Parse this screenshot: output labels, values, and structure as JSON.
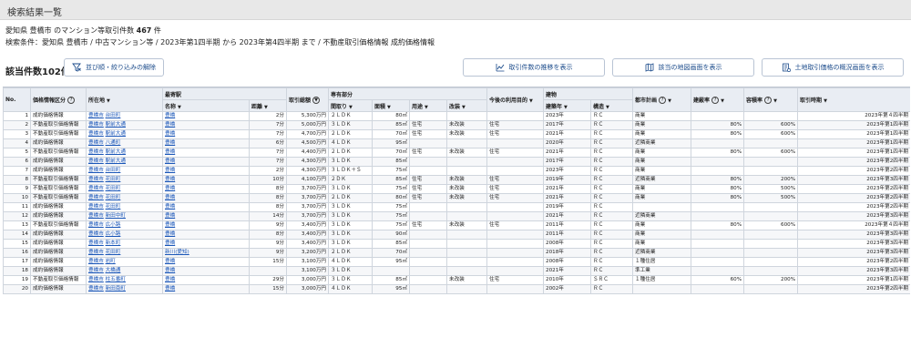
{
  "page_title": "検索結果一覧",
  "summary": {
    "prefix": "愛知県 豊橋市 のマンション等取引件数",
    "count": "467",
    "suffix": "件",
    "conditions": "検索条件：愛知県 豊橋市 / 中古マンション等 / 2023年第1四半期 から 2023年第4四半期 まで / 不動産取引価格情報 成約価格情報"
  },
  "result_count": "該当件数102件",
  "buttons": {
    "filter": "並び順・絞り込みの解除",
    "trend": "取引件数の推移を表示",
    "map": "該当の地図画面を表示",
    "overview": "土地取引価格の概況画面を表示"
  },
  "colors": {
    "link": "#1a56b8",
    "header_bg": "#e9edf3",
    "button_text": "#1a4a8a"
  },
  "table": {
    "headers": {
      "no": "No.",
      "price_type": "価格情報区分",
      "location": "所在地",
      "nearest_station": "最寄駅",
      "station_name": "名称",
      "distance": "距離",
      "total_price": "取引総額",
      "private_area": "専有部分",
      "layout": "間取り",
      "area": "面積",
      "usage": "用途",
      "renovation": "改装",
      "future_use": "今後の利用目的",
      "building": "建物",
      "built_year": "建築年",
      "structure": "構造",
      "city_plan": "都市計画",
      "coverage": "建蔽率",
      "far": "容積率",
      "period": "取引時期"
    },
    "rows": [
      {
        "no": "1",
        "type": "成約価格情報",
        "city": "豊橋市",
        "town": "台田町",
        "station": "豊橋",
        "dist": "2分",
        "price": "5,300万円",
        "layout": "２ＬＤＫ",
        "area": "80㎡",
        "usage": "",
        "reno": "",
        "future": "",
        "year": "2023年",
        "struct": "ＲＣ",
        "plan": "商業",
        "cov": "",
        "far": "",
        "period": "2023年第４四半期"
      },
      {
        "no": "2",
        "type": "不動産取引価格情報",
        "city": "豊橋市",
        "town": "駅前大通",
        "station": "豊橋",
        "dist": "7分",
        "price": "5,000万円",
        "layout": "３ＬＤＫ",
        "area": "85㎡",
        "usage": "住宅",
        "reno": "未改装",
        "future": "住宅",
        "year": "2017年",
        "struct": "ＲＣ",
        "plan": "商業",
        "cov": "80%",
        "far": "600%",
        "period": "2023年第1四半期"
      },
      {
        "no": "3",
        "type": "不動産取引価格情報",
        "city": "豊橋市",
        "town": "駅前大通",
        "station": "豊橋",
        "dist": "7分",
        "price": "4,700万円",
        "layout": "２ＬＤＫ",
        "area": "70㎡",
        "usage": "住宅",
        "reno": "未改装",
        "future": "住宅",
        "year": "2021年",
        "struct": "ＲＣ",
        "plan": "商業",
        "cov": "80%",
        "far": "600%",
        "period": "2023年第1四半期"
      },
      {
        "no": "4",
        "type": "成約価格情報",
        "city": "豊橋市",
        "town": "八通町",
        "station": "豊橋",
        "dist": "6分",
        "price": "4,500万円",
        "layout": "４ＬＤＫ",
        "area": "95㎡",
        "usage": "",
        "reno": "",
        "future": "",
        "year": "2020年",
        "struct": "ＲＣ",
        "plan": "近隣商業",
        "cov": "",
        "far": "",
        "period": "2023年第1四半期"
      },
      {
        "no": "5",
        "type": "不動産取引価格情報",
        "city": "豊橋市",
        "town": "駅前大通",
        "station": "豊橋",
        "dist": "7分",
        "price": "4,400万円",
        "layout": "２ＬＤＫ",
        "area": "70㎡",
        "usage": "住宅",
        "reno": "未改装",
        "future": "住宅",
        "year": "2021年",
        "struct": "ＲＣ",
        "plan": "商業",
        "cov": "80%",
        "far": "600%",
        "period": "2023年第1四半期"
      },
      {
        "no": "6",
        "type": "成約価格情報",
        "city": "豊橋市",
        "town": "駅前大通",
        "station": "豊橋",
        "dist": "7分",
        "price": "4,300万円",
        "layout": "３ＬＤＫ",
        "area": "85㎡",
        "usage": "",
        "reno": "",
        "future": "",
        "year": "2017年",
        "struct": "ＲＣ",
        "plan": "商業",
        "cov": "",
        "far": "",
        "period": "2023年第2四半期"
      },
      {
        "no": "7",
        "type": "成約価格情報",
        "city": "豊橋市",
        "town": "台田町",
        "station": "豊橋",
        "dist": "2分",
        "price": "4,300万円",
        "layout": "３ＬＤＫ＋Ｓ",
        "area": "75㎡",
        "usage": "",
        "reno": "",
        "future": "",
        "year": "2023年",
        "struct": "ＲＣ",
        "plan": "商業",
        "cov": "",
        "far": "",
        "period": "2023年第2四半期"
      },
      {
        "no": "8",
        "type": "不動産取引価格情報",
        "city": "豊橋市",
        "town": "花田町",
        "station": "豊橋",
        "dist": "10分",
        "price": "4,100万円",
        "layout": "２ＤＫ",
        "area": "85㎡",
        "usage": "住宅",
        "reno": "未改装",
        "future": "住宅",
        "year": "2019年",
        "struct": "ＲＣ",
        "plan": "近隣商業",
        "cov": "80%",
        "far": "200%",
        "period": "2023年第3四半期"
      },
      {
        "no": "9",
        "type": "不動産取引価格情報",
        "city": "豊橋市",
        "town": "花田町",
        "station": "豊橋",
        "dist": "8分",
        "price": "3,700万円",
        "layout": "３ＬＤＫ",
        "area": "75㎡",
        "usage": "住宅",
        "reno": "未改装",
        "future": "住宅",
        "year": "2021年",
        "struct": "ＲＣ",
        "plan": "商業",
        "cov": "80%",
        "far": "500%",
        "period": "2023年第2四半期"
      },
      {
        "no": "10",
        "type": "不動産取引価格情報",
        "city": "豊橋市",
        "town": "花田町",
        "station": "豊橋",
        "dist": "8分",
        "price": "3,700万円",
        "layout": "２ＬＤＫ",
        "area": "80㎡",
        "usage": "住宅",
        "reno": "未改装",
        "future": "住宅",
        "year": "2021年",
        "struct": "ＲＣ",
        "plan": "商業",
        "cov": "80%",
        "far": "500%",
        "period": "2023年第2四半期"
      },
      {
        "no": "11",
        "type": "成約価格情報",
        "city": "豊橋市",
        "town": "花田町",
        "station": "豊橋",
        "dist": "8分",
        "price": "3,700万円",
        "layout": "３ＬＤＫ",
        "area": "75㎡",
        "usage": "",
        "reno": "",
        "future": "",
        "year": "2019年",
        "struct": "ＲＣ",
        "plan": "",
        "cov": "",
        "far": "",
        "period": "2023年第2四半期"
      },
      {
        "no": "12",
        "type": "成約価格情報",
        "city": "豊橋市",
        "town": "新田中町",
        "station": "豊橋",
        "dist": "14分",
        "price": "3,700万円",
        "layout": "３ＬＤＫ",
        "area": "75㎡",
        "usage": "",
        "reno": "",
        "future": "",
        "year": "2021年",
        "struct": "ＲＣ",
        "plan": "近隣商業",
        "cov": "",
        "far": "",
        "period": "2023年第3四半期"
      },
      {
        "no": "13",
        "type": "不動産取引価格情報",
        "city": "豊橋市",
        "town": "広小路",
        "station": "豊橋",
        "dist": "9分",
        "price": "3,400万円",
        "layout": "３ＬＤＫ",
        "area": "75㎡",
        "usage": "住宅",
        "reno": "未改装",
        "future": "住宅",
        "year": "2011年",
        "struct": "ＲＣ",
        "plan": "商業",
        "cov": "80%",
        "far": "600%",
        "period": "2023年第４四半期"
      },
      {
        "no": "14",
        "type": "成約価格情報",
        "city": "豊橋市",
        "town": "広小路",
        "station": "豊橋",
        "dist": "8分",
        "price": "3,400万円",
        "layout": "３ＬＤＫ",
        "area": "90㎡",
        "usage": "",
        "reno": "",
        "future": "",
        "year": "2011年",
        "struct": "ＲＣ",
        "plan": "商業",
        "cov": "",
        "far": "",
        "period": "2023年第3四半期"
      },
      {
        "no": "15",
        "type": "成約価格情報",
        "city": "豊橋市",
        "town": "新本町",
        "station": "豊橋",
        "dist": "9分",
        "price": "3,400万円",
        "layout": "３ＬＤＫ",
        "area": "85㎡",
        "usage": "",
        "reno": "",
        "future": "",
        "year": "2008年",
        "struct": "ＲＣ",
        "plan": "商業",
        "cov": "",
        "far": "",
        "period": "2023年第3四半期"
      },
      {
        "no": "16",
        "type": "成約価格情報",
        "city": "豊橋市",
        "town": "花田町",
        "station": "新川(愛知)",
        "dist": "9分",
        "price": "3,200万円",
        "layout": "２ＬＤＫ",
        "area": "70㎡",
        "usage": "",
        "reno": "",
        "future": "",
        "year": "2018年",
        "struct": "ＲＣ",
        "plan": "近隣商業",
        "cov": "",
        "far": "",
        "period": "2023年第3四半期"
      },
      {
        "no": "17",
        "type": "成約価格情報",
        "city": "豊橋市",
        "town": "岩町",
        "station": "豊橋",
        "dist": "15分",
        "price": "3,100万円",
        "layout": "４ＬＤＫ",
        "area": "95㎡",
        "usage": "",
        "reno": "",
        "future": "",
        "year": "2008年",
        "struct": "ＲＣ",
        "plan": "１種住居",
        "cov": "",
        "far": "",
        "period": "2023年第2四半期"
      },
      {
        "no": "18",
        "type": "成約価格情報",
        "city": "豊橋市",
        "town": "大橋通",
        "station": "豊橋",
        "dist": "",
        "price": "3,100万円",
        "layout": "３ＬＤＫ",
        "area": "",
        "usage": "",
        "reno": "",
        "future": "",
        "year": "2021年",
        "struct": "ＲＣ",
        "plan": "準工業",
        "cov": "",
        "far": "",
        "period": "2023年第3四半期"
      },
      {
        "no": "19",
        "type": "不動産取引価格情報",
        "city": "豊橋市",
        "town": "柱五番町",
        "station": "豊橋",
        "dist": "29分",
        "price": "3,000万円",
        "layout": "３ＬＤＫ",
        "area": "85㎡",
        "usage": "",
        "reno": "未改装",
        "future": "住宅",
        "year": "2010年",
        "struct": "ＳＲＣ",
        "plan": "１種住居",
        "cov": "60%",
        "far": "200%",
        "period": "2023年第1四半期"
      },
      {
        "no": "20",
        "type": "成約価格情報",
        "city": "豊橋市",
        "town": "新田南町",
        "station": "豊橋",
        "dist": "15分",
        "price": "3,000万円",
        "layout": "４ＬＤＫ",
        "area": "95㎡",
        "usage": "",
        "reno": "",
        "future": "",
        "year": "2002年",
        "struct": "ＲＣ",
        "plan": "",
        "cov": "",
        "far": "",
        "period": "2023年第2四半期"
      }
    ]
  }
}
